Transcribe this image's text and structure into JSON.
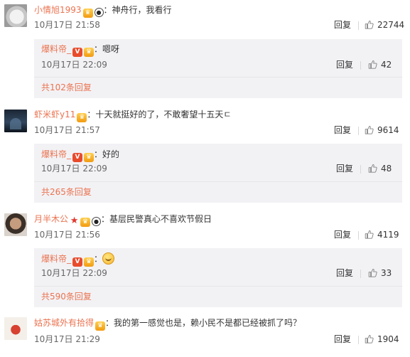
{
  "comments": [
    {
      "username": "小情旭1993",
      "text": "：神舟行，我看行",
      "time": "10月17日 21:58",
      "reply_label": "回复",
      "likes": "22744",
      "sub": {
        "username": "爆料帝_",
        "text": "：嗯呀",
        "time": "10月17日 22:09",
        "reply_label": "回复",
        "likes": "42",
        "more": "共102条回复"
      }
    },
    {
      "username": "虾米虾y11",
      "text": "：十天就挺好的了，不敢奢望十五天ㄷ",
      "time": "10月17日 21:57",
      "reply_label": "回复",
      "likes": "9614",
      "sub": {
        "username": "爆料帝_",
        "text": "：好的",
        "time": "10月17日 22:09",
        "reply_label": "回复",
        "likes": "48",
        "more": "共265条回复"
      }
    },
    {
      "username": "月半木公",
      "text": "：基层民警真心不喜欢节假日",
      "time": "10月17日 21:56",
      "reply_label": "回复",
      "likes": "4119",
      "sub": {
        "username": "爆料帝_",
        "text": "：",
        "time": "10月17日 22:09",
        "reply_label": "回复",
        "likes": "33",
        "more": "共590条回复"
      }
    },
    {
      "username": "姑苏城外有拾得",
      "text": "：我的第一感觉也是，赖小民不是都已经被抓了吗？",
      "time": "10月17日 21:29",
      "reply_label": "回复",
      "likes": "1904"
    }
  ],
  "icons": {
    "like": "thumbs-up-icon",
    "vip": "vip-crown-icon",
    "panda": "panda-icon",
    "verified": "verified-v-icon",
    "star": "star-icon",
    "smile": "smile-emoji-icon"
  },
  "colors": {
    "username": "#eb7350",
    "reply_box": "#f2f2f5",
    "verified": "#e84b2c"
  }
}
